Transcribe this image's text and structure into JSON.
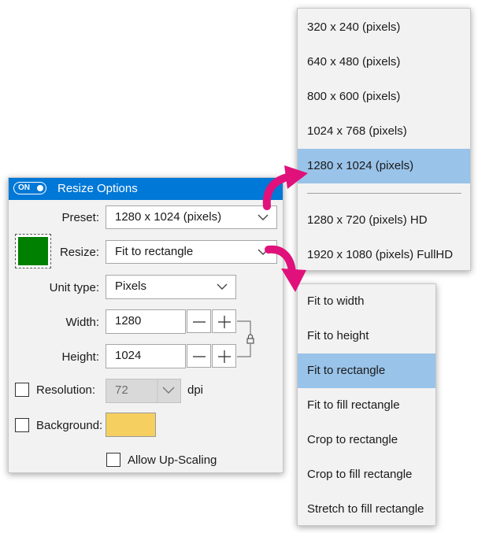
{
  "panel": {
    "toggle_label": "ON",
    "title": "Resize Options",
    "preset": {
      "label": "Preset:",
      "value": "1280 x 1024 (pixels)"
    },
    "resize": {
      "label": "Resize:",
      "value": "Fit to rectangle"
    },
    "unit_type": {
      "label": "Unit type:",
      "value": "Pixels"
    },
    "width": {
      "label": "Width:",
      "value": "1280"
    },
    "height": {
      "label": "Height:",
      "value": "1024"
    },
    "resolution": {
      "label": "Resolution:",
      "value": "72",
      "unit": "dpi",
      "checked": false
    },
    "background": {
      "label": "Background:",
      "checked": false,
      "color": "#f5d061"
    },
    "allow_upscaling": {
      "label": "Allow Up-Scaling",
      "checked": false
    },
    "swatch_color": "#008000",
    "accent_color": "#0078d7"
  },
  "preset_menu": {
    "items": [
      "320 x 240 (pixels)",
      "640 x 480 (pixels)",
      "800 x 600 (pixels)",
      "1024 x 768 (pixels)",
      "1280 x 1024 (pixels)",
      "1280 x 720 (pixels) HD",
      "1920 x 1080 (pixels) FullHD"
    ],
    "selected": "1280 x 1024 (pixels)"
  },
  "resize_menu": {
    "items": [
      "Fit to width",
      "Fit to height",
      "Fit to rectangle",
      "Fit to fill rectangle",
      "Crop to rectangle",
      "Crop to fill rectangle",
      "Stretch to fill rectangle"
    ],
    "selected": "Fit to rectangle"
  },
  "selection_color": "#99c3e9",
  "arrow_color": "#e0117a"
}
